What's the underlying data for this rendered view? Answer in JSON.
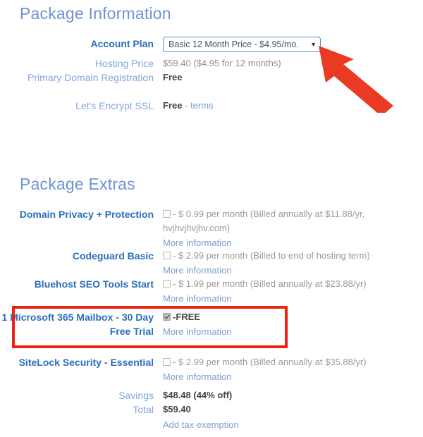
{
  "package_information": {
    "heading": "Package Information",
    "rows": [
      {
        "label": "Account Plan",
        "label_style": "bold",
        "control": "select",
        "selected_option": "Basic 12 Month Price - $4.95/mo.",
        "caret_icon": "chevron-down-icon"
      },
      {
        "label": "Hosting Price",
        "label_style": "light",
        "value": "$59.40  ($4.95 for 12 months)"
      },
      {
        "label": "Primary Domain Registration",
        "label_style": "light",
        "value": "Free"
      },
      {
        "label": "Let's Encrypt SSL",
        "label_style": "light",
        "value": "Free",
        "value_suffix_dash": "-",
        "value_link": "terms"
      }
    ]
  },
  "package_extras": {
    "heading": "Package Extras",
    "items": [
      {
        "label": "Domain Privacy + Protection",
        "checked": false,
        "description": "- $ 0.99 per month (Billed annually at $11.88/yr, hvjhvjhvjhv.com)",
        "more_information": "More information"
      },
      {
        "label": "Codeguard Basic",
        "checked": false,
        "description": "- $ 2.99 per month (Billed to end of hosting term)",
        "more_information": "More information"
      },
      {
        "label": "Bluehost SEO Tools Start",
        "checked": false,
        "description": "- $ 1.99 per month (Billed annually at $23.88/yr)",
        "more_information": "More information"
      },
      {
        "label": "1 Microsoft 365 Mailbox - 30 Day Free Trial",
        "checked": true,
        "description": "-FREE",
        "more_information": "More information",
        "highlighted": true
      },
      {
        "label": "SiteLock Security - Essential",
        "checked": false,
        "description": "- $ 2.99 per month (Billed annually at $35.88/yr)",
        "more_information": "More information"
      }
    ],
    "totals": [
      {
        "label": "Savings",
        "value": "$48.48 (44% off)"
      },
      {
        "label": "Total",
        "value": "$59.40"
      }
    ],
    "tax_link": "Add tax exemption"
  },
  "annotations": {
    "arrow_color": "#ea3a23",
    "highlight_color": "#ee2211",
    "arrow_target": "account-plan-select",
    "highlight_target": "microsoft-365-extra-row"
  },
  "colors": {
    "heading_blue": "#6f93d4",
    "label_bold_blue": "#2a6ebb",
    "label_light_blue": "#85a6dd",
    "link_blue": "#7ba0d0",
    "value_dark": "#444444",
    "value_muted": "#9a9a9a",
    "select_border": "#5b8ccd"
  }
}
